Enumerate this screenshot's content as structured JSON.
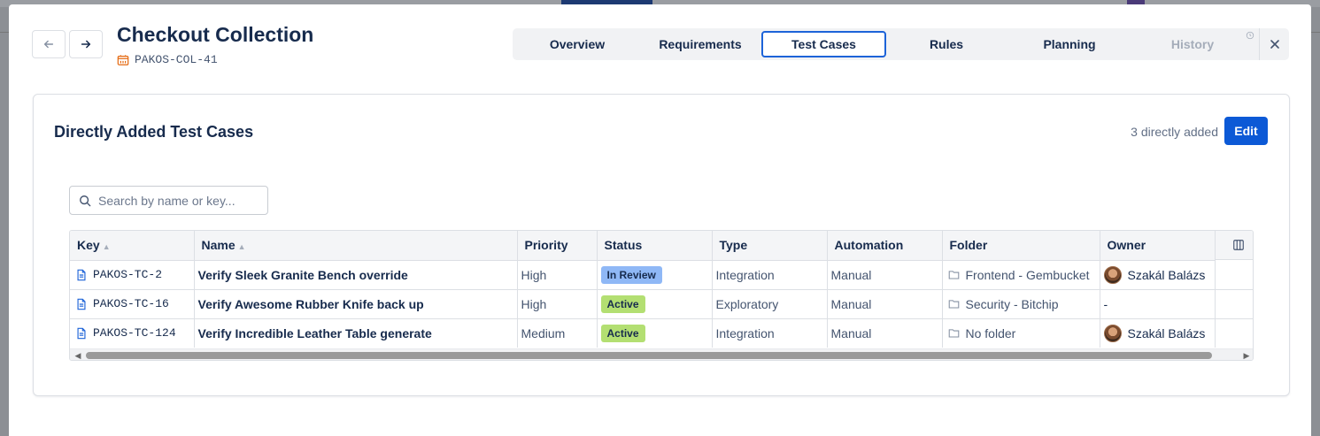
{
  "header": {
    "title": "Checkout Collection",
    "key": "PAKOS-COL-41"
  },
  "tabs": [
    {
      "label": "Overview",
      "state": "normal"
    },
    {
      "label": "Requirements",
      "state": "normal"
    },
    {
      "label": "Test Cases",
      "state": "active"
    },
    {
      "label": "Rules",
      "state": "normal"
    },
    {
      "label": "Planning",
      "state": "normal"
    },
    {
      "label": "History",
      "state": "disabled"
    }
  ],
  "section": {
    "title": "Directly Added Test Cases",
    "count_text": "3 directly added",
    "edit_label": "Edit"
  },
  "search": {
    "placeholder": "Search by name or key..."
  },
  "table": {
    "columns": [
      "Key",
      "Name",
      "Priority",
      "Status",
      "Type",
      "Automation",
      "Folder",
      "Owner"
    ],
    "rows": [
      {
        "key": "PAKOS-TC-2",
        "name": "Verify Sleek Granite Bench override",
        "priority": "High",
        "status": "In Review",
        "type": "Integration",
        "automation": "Manual",
        "folder": "Frontend - Gembucket",
        "owner": "Szakál Balázs"
      },
      {
        "key": "PAKOS-TC-16",
        "name": "Verify Awesome Rubber Knife back up",
        "priority": "High",
        "status": "Active",
        "type": "Exploratory",
        "automation": "Manual",
        "folder": "Security - Bitchip",
        "owner": "-"
      },
      {
        "key": "PAKOS-TC-124",
        "name": "Verify Incredible Leather Table generate",
        "priority": "Medium",
        "status": "Active",
        "type": "Integration",
        "automation": "Manual",
        "folder": "No folder",
        "owner": "Szakál Balázs"
      }
    ]
  },
  "colors": {
    "accent": "#0c59d6",
    "active_tab_border": "#1d63d8",
    "status_in_review": "#8fb8f6",
    "status_active": "#b3df72",
    "key_icon": "#e56910"
  }
}
